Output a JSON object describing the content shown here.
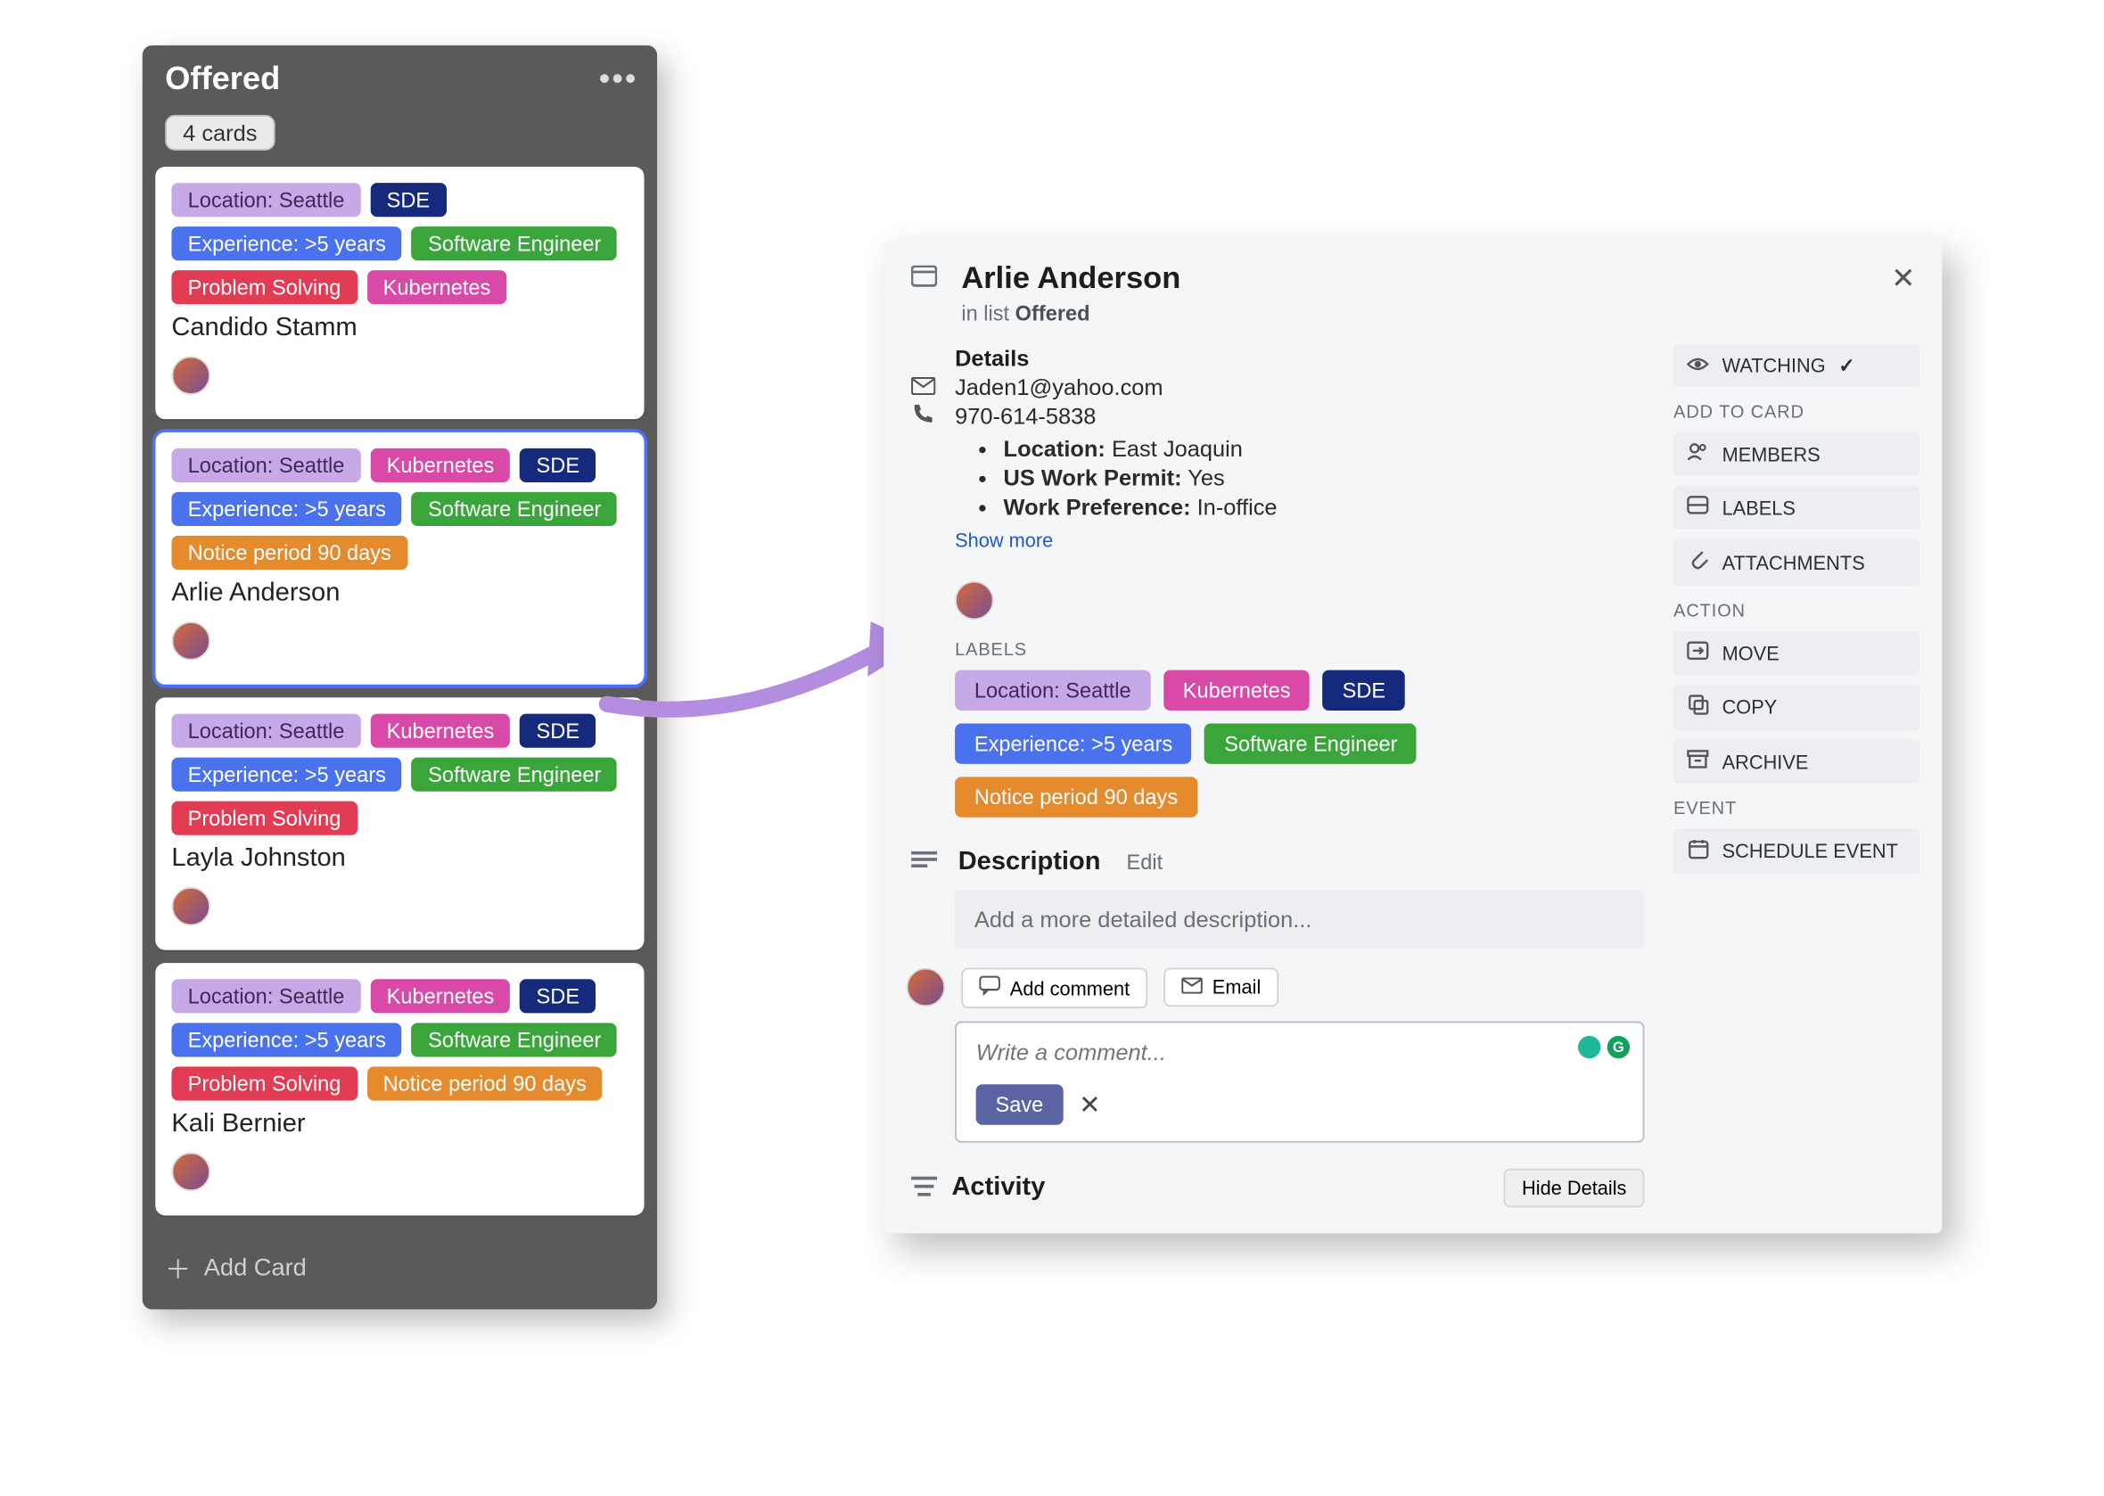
{
  "column": {
    "title": "Offered",
    "count_badge": "4 cards",
    "add_card": "Add Card"
  },
  "label_colors": {
    "c-purple": "#c7a9e8",
    "c-navy": "#162a7d",
    "c-sky": "#4a72ef",
    "c-green": "#3aa53a",
    "c-red": "#e23c55",
    "c-magenta": "#d94aa8",
    "c-orange": "#e68a2e"
  },
  "cards": [
    {
      "name": "Candido Stamm",
      "labels": [
        {
          "text": "Location: Seattle",
          "color": "c-purple"
        },
        {
          "text": "SDE",
          "color": "c-navy"
        },
        {
          "text": "Experience: >5 years",
          "color": "c-sky"
        },
        {
          "text": "Software Engineer",
          "color": "c-green"
        },
        {
          "text": "Problem Solving",
          "color": "c-red"
        },
        {
          "text": "Kubernetes",
          "color": "c-magenta"
        }
      ]
    },
    {
      "name": "Arlie Anderson",
      "selected": true,
      "labels": [
        {
          "text": "Location: Seattle",
          "color": "c-purple"
        },
        {
          "text": "Kubernetes",
          "color": "c-magenta"
        },
        {
          "text": "SDE",
          "color": "c-navy"
        },
        {
          "text": "Experience: >5 years",
          "color": "c-sky"
        },
        {
          "text": "Software Engineer",
          "color": "c-green"
        },
        {
          "text": "Notice period 90 days",
          "color": "c-orange"
        }
      ]
    },
    {
      "name": "Layla Johnston",
      "labels": [
        {
          "text": "Location: Seattle",
          "color": "c-purple"
        },
        {
          "text": "Kubernetes",
          "color": "c-magenta"
        },
        {
          "text": "SDE",
          "color": "c-navy"
        },
        {
          "text": "Experience: >5 years",
          "color": "c-sky"
        },
        {
          "text": "Software Engineer",
          "color": "c-green"
        },
        {
          "text": "Problem Solving",
          "color": "c-red"
        }
      ]
    },
    {
      "name": "Kali Bernier",
      "labels": [
        {
          "text": "Location: Seattle",
          "color": "c-purple"
        },
        {
          "text": "Kubernetes",
          "color": "c-magenta"
        },
        {
          "text": "SDE",
          "color": "c-navy"
        },
        {
          "text": "Experience: >5 years",
          "color": "c-sky"
        },
        {
          "text": "Software Engineer",
          "color": "c-green"
        },
        {
          "text": "Problem Solving",
          "color": "c-red"
        },
        {
          "text": "Notice period 90 days",
          "color": "c-orange"
        }
      ]
    }
  ],
  "modal": {
    "title": "Arlie Anderson",
    "in_list_prefix": "in list ",
    "in_list": "Offered",
    "details_h": "Details",
    "email": "Jaden1@yahoo.com",
    "phone": "970-614-5838",
    "bullets": [
      {
        "k": "Location:",
        "v": " East Joaquin"
      },
      {
        "k": "US Work Permit:",
        "v": " Yes"
      },
      {
        "k": "Work Preference:",
        "v": " In-office"
      }
    ],
    "show_more": "Show more",
    "labels_h": "LABELS",
    "labels": [
      {
        "text": "Location: Seattle",
        "color": "c-purple"
      },
      {
        "text": "Kubernetes",
        "color": "c-magenta"
      },
      {
        "text": "SDE",
        "color": "c-navy"
      },
      {
        "text": "Experience: >5 years",
        "color": "c-sky"
      },
      {
        "text": "Software Engineer",
        "color": "c-green"
      },
      {
        "text": "Notice period 90 days",
        "color": "c-orange"
      }
    ],
    "description_h": "Description",
    "edit": "Edit",
    "description_placeholder": "Add a more detailed description...",
    "add_comment": "Add comment",
    "email_tab": "Email",
    "comment_placeholder": "Write a comment...",
    "save": "Save",
    "activity_h": "Activity",
    "hide_details": "Hide Details",
    "side": {
      "watching": "WATCHING",
      "add_to_card": "ADD TO CARD",
      "members": "MEMBERS",
      "labels": "LABELS",
      "attachments": "ATTACHMENTS",
      "action": "ACTION",
      "move": "MOVE",
      "copy": "COPY",
      "archive": "ARCHIVE",
      "event": "EVENT",
      "schedule_event": "SCHEDULE EVENT"
    }
  }
}
